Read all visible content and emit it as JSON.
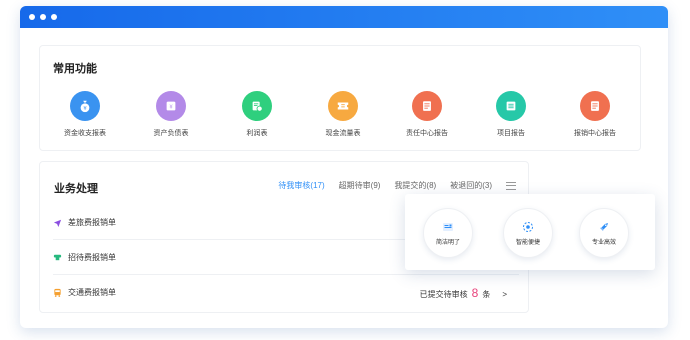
{
  "common": {
    "title": "常用功能",
    "items": [
      {
        "label": "资金收支报表",
        "color": "#3a93f0",
        "icon": "money-bag-icon"
      },
      {
        "label": "资产负债表",
        "color": "#b38ae8",
        "icon": "wallet-icon"
      },
      {
        "label": "利润表",
        "color": "#2fcf7e",
        "icon": "profit-report-icon"
      },
      {
        "label": "现金流量表",
        "color": "#f7a940",
        "icon": "ticket-icon"
      },
      {
        "label": "责任中心报告",
        "color": "#f07050",
        "icon": "document-icon"
      },
      {
        "label": "项目报告",
        "color": "#26c8a8",
        "icon": "list-report-icon"
      },
      {
        "label": "报销中心报告",
        "color": "#f07050",
        "icon": "document-icon"
      }
    ]
  },
  "business": {
    "title": "业务处理",
    "tabs": [
      {
        "label": "待我审核(17)",
        "active": true
      },
      {
        "label": "超期待审(9)",
        "active": false
      },
      {
        "label": "我提交的(8)",
        "active": false
      },
      {
        "label": "被退回的(3)",
        "active": false
      }
    ],
    "rows": [
      {
        "label": "差旅费报销单",
        "icon": "airplane-icon",
        "color": "#8b4fe0"
      },
      {
        "label": "招待费报销单",
        "icon": "hospitality-icon",
        "color": "#27b97f"
      },
      {
        "label": "交通费报销单",
        "icon": "bus-icon",
        "color": "#f5a030"
      }
    ],
    "status": {
      "prefix": "已提交待审核",
      "count": "8",
      "suffix": "条",
      "arrow": ">"
    }
  },
  "features": [
    {
      "label": "简洁明了",
      "icon": "simple-doc-icon",
      "color": "#2f8ff7"
    },
    {
      "label": "智能便捷",
      "icon": "smart-icon",
      "color": "#2f8ff7"
    },
    {
      "label": "专业高效",
      "icon": "rocket-icon",
      "color": "#2f8ff7"
    }
  ]
}
